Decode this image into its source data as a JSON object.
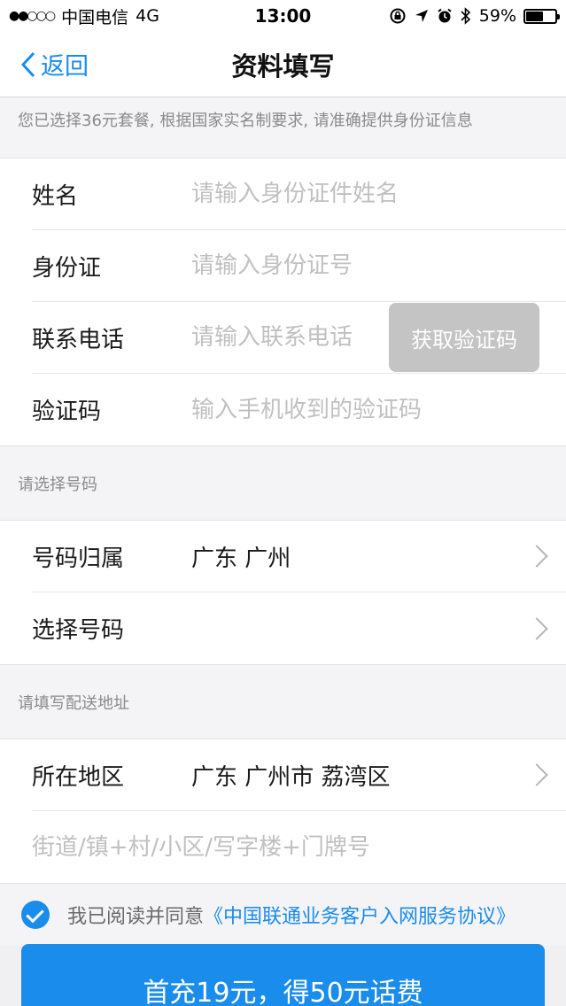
{
  "status_bar": {
    "signal": "●●○○○",
    "carrier": "中国电信",
    "network": "4G",
    "time": "13:00",
    "battery": "59%",
    "battery_level": 0.59,
    "icons": [
      "rotation-lock-icon",
      "location-arrow-icon",
      "alarm-icon",
      "bluetooth-icon",
      "battery-icon"
    ]
  },
  "nav": {
    "back_label": "返回",
    "title": "资料填写"
  },
  "notice": "您已选择36元套餐, 根据国家实名制要求, 请准确提供身份证信息",
  "identity": {
    "name_label": "姓名",
    "name_placeholder": "请输入身份证件姓名",
    "id_label": "身份证",
    "id_placeholder": "请输入身份证号",
    "phone_label": "联系电话",
    "phone_placeholder": "请输入联系电话",
    "get_code_label": "获取验证码",
    "code_label": "验证码",
    "code_placeholder": "输入手机收到的验证码"
  },
  "number_section": {
    "header": "请选择号码",
    "region_label": "号码归属",
    "region_value": "广东 广州",
    "select_label": "选择号码"
  },
  "address_section": {
    "header": "请填写配送地址",
    "area_label": "所在地区",
    "area_value": "广东 广州市 荔湾区",
    "street_placeholder": "街道/镇+村/小区/写字楼+门牌号"
  },
  "agreement": {
    "prefix": "我已阅读并同意",
    "link": "《中国联通业务客户入网服务协议》"
  },
  "submit_label": "首充19元，得50元话费",
  "colors": {
    "accent": "#1a8cec",
    "disabled_button": "#c4c4c4"
  }
}
